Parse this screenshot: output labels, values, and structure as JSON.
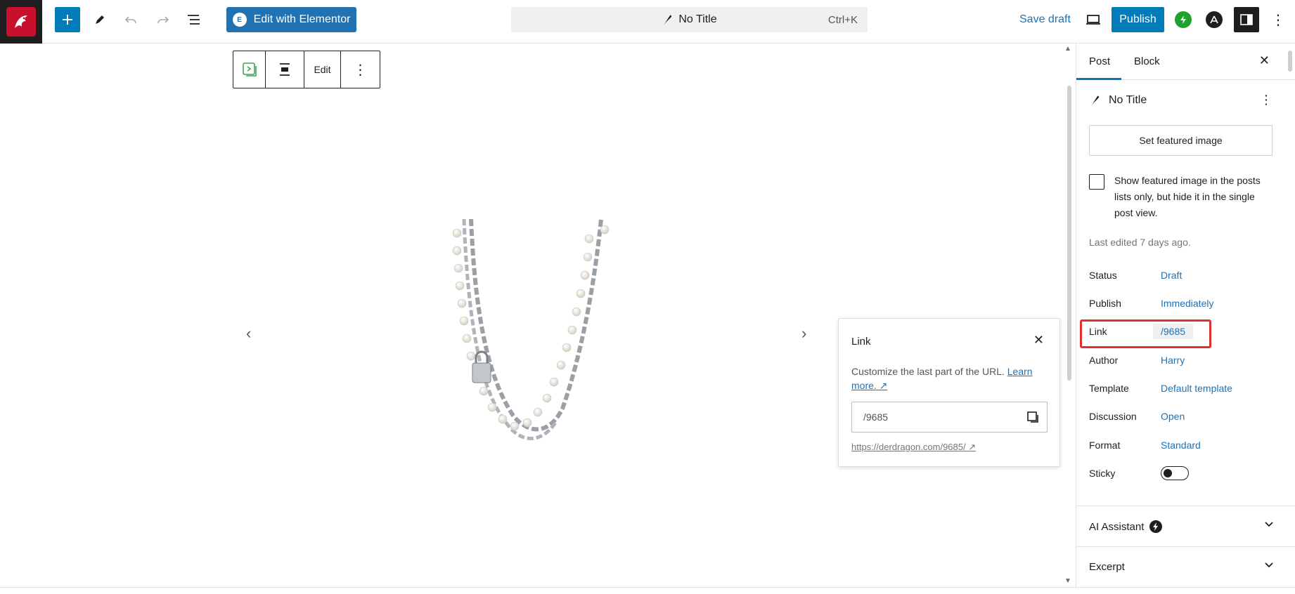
{
  "topbar": {
    "elementor_label": "Edit with Elementor",
    "command_title": "No Title",
    "command_shortcut": "Ctrl+K",
    "save_draft_label": "Save draft",
    "publish_label": "Publish"
  },
  "block_toolbar": {
    "edit_label": "Edit"
  },
  "link_popover": {
    "title": "Link",
    "help_text": "Customize the last part of the URL.",
    "learn_more": "Learn more.",
    "slug": "/9685",
    "full_url": "https://derdragon.com/9685/"
  },
  "sidebar": {
    "tabs": [
      {
        "label": "Post"
      },
      {
        "label": "Block"
      }
    ],
    "post_title": "No Title",
    "featured_image_button": "Set featured image",
    "featured_checkbox_label": "Show featured image in the posts lists only, but hide it in the single post view.",
    "last_edited": "Last edited 7 days ago.",
    "meta": {
      "status": {
        "label": "Status",
        "value": "Draft"
      },
      "publish": {
        "label": "Publish",
        "value": "Immediately"
      },
      "link": {
        "label": "Link",
        "value": "/9685"
      },
      "author": {
        "label": "Author",
        "value": "Harry"
      },
      "template": {
        "label": "Template",
        "value": "Default template"
      },
      "discussion": {
        "label": "Discussion",
        "value": "Open"
      },
      "format": {
        "label": "Format",
        "value": "Standard"
      },
      "sticky": {
        "label": "Sticky"
      }
    },
    "sections": [
      {
        "label": "AI Assistant"
      },
      {
        "label": "Excerpt"
      }
    ]
  },
  "colors": {
    "accent": "#007cba",
    "link": "#2271b1",
    "highlight": "#e03131"
  }
}
